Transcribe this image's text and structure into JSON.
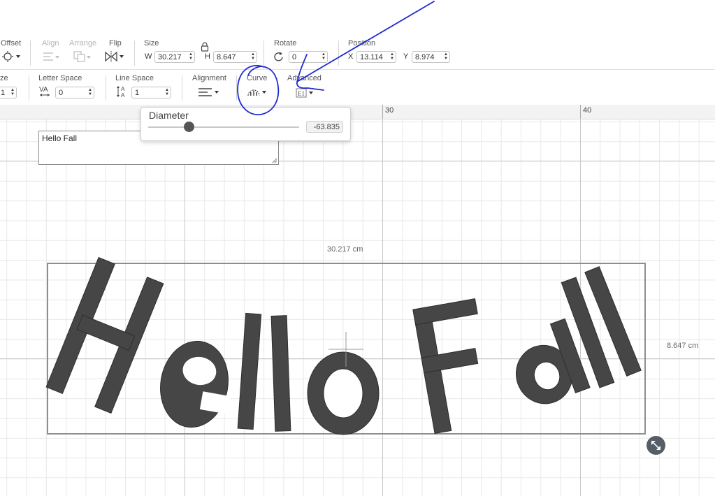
{
  "toolbar_top": {
    "offset_label": "Offset",
    "align_label": "Align",
    "arrange_label": "Arrange",
    "flip_label": "Flip",
    "size_label": "Size",
    "w_label": "W",
    "w_value": "30.217",
    "h_label": "H",
    "h_value": "8.647",
    "rotate_label": "Rotate",
    "rotate_value": "0",
    "position_label": "Position",
    "x_label": "X",
    "x_value": "13.114",
    "y_label": "Y",
    "y_value": "8.974"
  },
  "toolbar_text": {
    "size_label": "ze",
    "size_value": "1",
    "letter_space_label": "Letter Space",
    "letter_space_value": "0",
    "line_space_label": "Line Space",
    "line_space_value": "1",
    "alignment_label": "Alignment",
    "curve_label": "Curve",
    "advanced_label": "Advanced"
  },
  "ruler": {
    "marks": [
      "30",
      "40"
    ]
  },
  "curve_popup": {
    "title": "Diameter",
    "value": "-63.835",
    "slider_fraction": 0.27
  },
  "text_box": {
    "value": "Hello Fall"
  },
  "design": {
    "text": "Hello Fall",
    "letters": [
      "H",
      "e",
      "l",
      "l",
      "o",
      "F",
      "a",
      "l",
      "l"
    ],
    "width_label": "30.217 cm",
    "height_label": "8.647 cm",
    "fill_color": "#464646",
    "annotation_color": "#1f2ad1"
  }
}
